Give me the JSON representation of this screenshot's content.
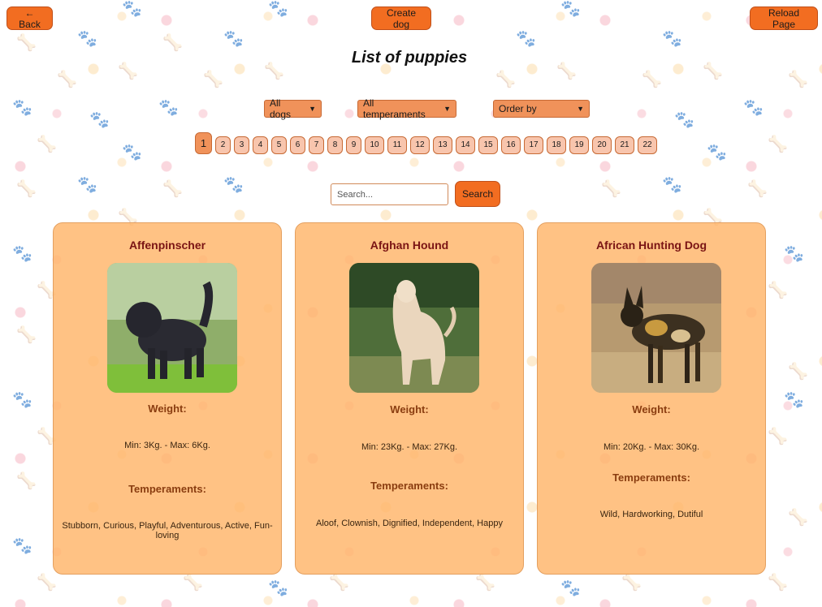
{
  "header": {
    "back_label": "← Back",
    "create_label": "Create dog",
    "reload_label": "Reload Page"
  },
  "title": "List of puppies",
  "filters": {
    "dogs": "All dogs",
    "temperaments": "All temperaments",
    "order": "Order by"
  },
  "pagination": {
    "current": "1",
    "pages": [
      "1",
      "2",
      "3",
      "4",
      "5",
      "6",
      "7",
      "8",
      "9",
      "10",
      "11",
      "12",
      "13",
      "14",
      "15",
      "16",
      "17",
      "18",
      "19",
      "20",
      "21",
      "22"
    ]
  },
  "search": {
    "placeholder": "Search...",
    "button_label": "Search"
  },
  "cards": [
    {
      "name": "Affenpinscher",
      "weight_label": "Weight:",
      "weight": "Min: 3Kg. - Max: 6Kg.",
      "temperaments_label": "Temperaments:",
      "temperaments": "Stubborn, Curious, Playful, Adventurous, Active, Fun-loving"
    },
    {
      "name": "Afghan Hound",
      "weight_label": "Weight:",
      "weight": "Min: 23Kg. - Max: 27Kg.",
      "temperaments_label": "Temperaments:",
      "temperaments": "Aloof, Clownish, Dignified, Independent, Happy"
    },
    {
      "name": "African Hunting Dog",
      "weight_label": "Weight:",
      "weight": "Min: 20Kg. - Max: 30Kg.",
      "temperaments_label": "Temperaments:",
      "temperaments": "Wild, Hardworking, Dutiful"
    }
  ],
  "colors": {
    "accent": "#f26d21",
    "card_bg": "#ffb469",
    "card_title": "#7a1414",
    "label": "#8a3d10"
  }
}
